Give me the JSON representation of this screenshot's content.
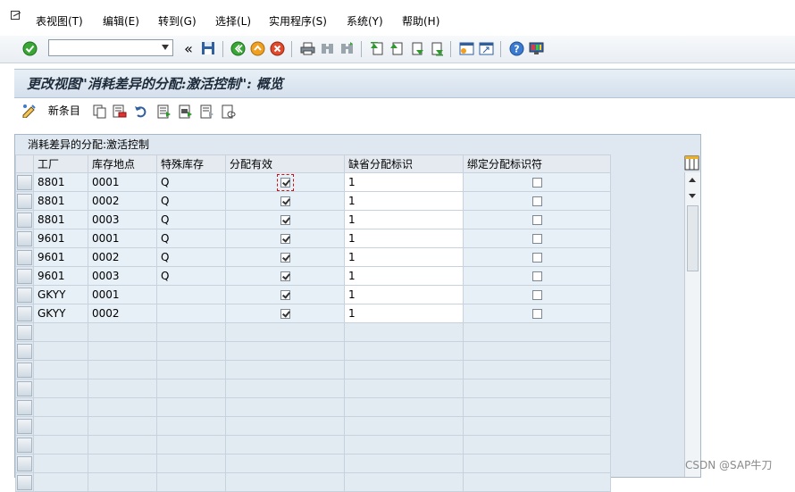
{
  "menu": {
    "items": [
      "表视图(T)",
      "编辑(E)",
      "转到(G)",
      "选择(L)",
      "实用程序(S)",
      "系统(Y)",
      "帮助(H)"
    ]
  },
  "toolbar": {
    "command_field_value": "",
    "history_label": "«",
    "icons": [
      "enter-icon",
      "save-icon",
      "back-icon",
      "exit-icon",
      "cancel-icon",
      "print-icon",
      "find-icon",
      "find-next-icon",
      "first-page-icon",
      "previous-page-icon",
      "next-page-icon",
      "last-page-icon",
      "create-session-icon",
      "shortcut-icon",
      "help-icon",
      "customize-layout-icon"
    ]
  },
  "title": "更改视图\"消耗差异的分配:激活控制\": 概览",
  "app_toolbar": {
    "new_entries_label": "新条目"
  },
  "table": {
    "title": "消耗差异的分配:激活控制",
    "columns": [
      "工厂",
      "库存地点",
      "特殊库存",
      "分配有效",
      "缺省分配标识",
      "绑定分配标识符"
    ],
    "rows": [
      {
        "plant": "8801",
        "sloc": "0001",
        "special": "Q",
        "active": true,
        "default": "1",
        "bound": false
      },
      {
        "plant": "8801",
        "sloc": "0002",
        "special": "Q",
        "active": true,
        "default": "1",
        "bound": false
      },
      {
        "plant": "8801",
        "sloc": "0003",
        "special": "Q",
        "active": true,
        "default": "1",
        "bound": false
      },
      {
        "plant": "9601",
        "sloc": "0001",
        "special": "Q",
        "active": true,
        "default": "1",
        "bound": false
      },
      {
        "plant": "9601",
        "sloc": "0002",
        "special": "Q",
        "active": true,
        "default": "1",
        "bound": false
      },
      {
        "plant": "9601",
        "sloc": "0003",
        "special": "Q",
        "active": true,
        "default": "1",
        "bound": false
      },
      {
        "plant": "GKYY",
        "sloc": "0001",
        "special": "",
        "active": true,
        "default": "1",
        "bound": false
      },
      {
        "plant": "GKYY",
        "sloc": "0002",
        "special": "",
        "active": true,
        "default": "1",
        "bound": false
      }
    ],
    "empty_rows": 9
  },
  "watermark": "CSDN @SAP牛刀",
  "colors": {
    "accent": "#1e2b3a",
    "panel": "#dfe8f0",
    "checkmark": "#333333"
  }
}
